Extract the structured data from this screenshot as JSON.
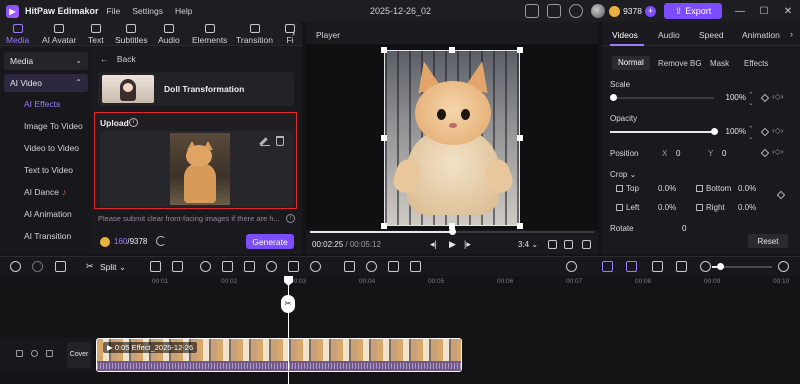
{
  "titlebar": {
    "app_name": "HitPaw Edimakor",
    "menus": [
      "File",
      "Settings",
      "Help"
    ],
    "project_title": "2025-12-26_02",
    "credits": "9378",
    "export_label": "Export"
  },
  "toptabs": [
    "Media",
    "AI Avatar",
    "Text",
    "Subtitles",
    "Audio",
    "Elements",
    "Transition",
    "Fi"
  ],
  "sidebar": {
    "group1": "Media",
    "group2": "AI Video",
    "items": [
      "AI Effects",
      "Image To Video",
      "Video to Video",
      "Text to Video",
      "AI Dance",
      "AI Animation",
      "AI Transition"
    ]
  },
  "content": {
    "back": "Back",
    "effect_title": "Doll Transformation",
    "upload_label": "Upload",
    "hint": "Please submit clear front-facing images if there are h...",
    "credits_used": "160",
    "credits_total": "/9378",
    "generate_label": "Generate"
  },
  "player": {
    "title": "Player",
    "time_current": "00:02:25",
    "time_total": "/ 00:05:12",
    "ratio": "3:4",
    "progress": 0.5
  },
  "rightpanel": {
    "tabs": [
      "Videos",
      "Audio",
      "Speed",
      "Animation"
    ],
    "subtabs": [
      "Normal",
      "Remove BG",
      "Mask",
      "Effects"
    ],
    "scale_label": "Scale",
    "scale_value": "100%",
    "scale_level": 0.0,
    "opacity_label": "Opacity",
    "opacity_value": "100%",
    "opacity_level": 1.0,
    "position_label": "Position",
    "pos_x_label": "X",
    "pos_x": "0",
    "pos_y_label": "Y",
    "pos_y": "0",
    "crop_label": "Crop",
    "crop_top_label": "Top",
    "crop_top": "0.0%",
    "crop_bottom_label": "Bottom",
    "crop_bottom": "0.0%",
    "crop_left_label": "Left",
    "crop_left": "0.0%",
    "crop_right_label": "Right",
    "crop_right": "0.0%",
    "rotate_label": "Rotate",
    "rotate_value": "0",
    "reset_label": "Reset"
  },
  "timeline": {
    "split_label": "Split",
    "ticks": [
      "00:01",
      "00:02",
      "00:03",
      "00:04",
      "00:05",
      "00:06",
      "00:07",
      "00:08",
      "00:09",
      "00:10"
    ],
    "cover_label": "Cover",
    "clip_label": "0:05 Effect_2025-12-26",
    "zoom_level": 0.1
  },
  "colors": {
    "accent": "#7b4dff",
    "highlight_border": "#e02a2a"
  }
}
